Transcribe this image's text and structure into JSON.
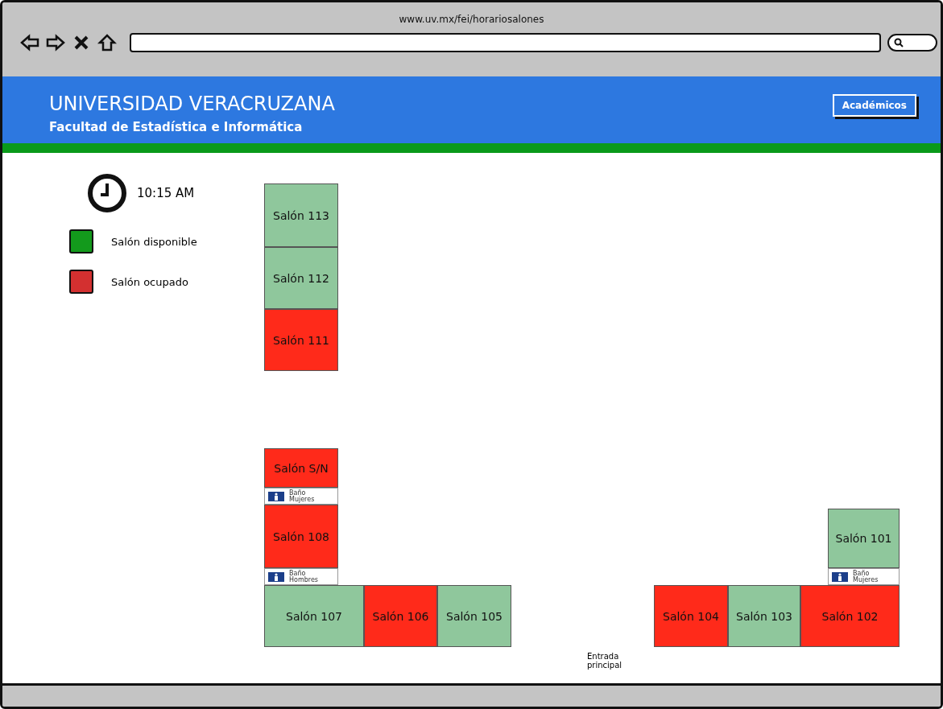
{
  "browser": {
    "url": "www.uv.mx/fei/horariosalones"
  },
  "header": {
    "title": "UNIVERSIDAD VERACRUZANA",
    "subtitle": "Facultad de Estadística e Informática",
    "button": "Académicos"
  },
  "clock": {
    "time": "10:15 AM"
  },
  "legend": [
    {
      "label": "Salón disponible",
      "color": "#139a1c"
    },
    {
      "label": "Salón ocupado",
      "color": "#d33030"
    }
  ],
  "rooms": [
    {
      "kind": "room",
      "label": "Salón 113",
      "occupied": false
    },
    {
      "kind": "room",
      "label": "Salón 112",
      "occupied": false
    },
    {
      "kind": "room",
      "label": "Salón 111",
      "occupied": true
    },
    {
      "kind": "room",
      "label": "Salón S/N",
      "occupied": true
    },
    {
      "kind": "restroom",
      "label": "Baño Mujeres"
    },
    {
      "kind": "room",
      "label": "Salón 108",
      "occupied": true
    },
    {
      "kind": "room",
      "label": "Salón 101",
      "occupied": false
    },
    {
      "kind": "restroom",
      "label": "Baño Hombres"
    },
    {
      "kind": "restroom",
      "label": "Baño Mujeres"
    },
    {
      "kind": "room",
      "label": "Salón 107",
      "occupied": false
    },
    {
      "kind": "room",
      "label": "Salón 106",
      "occupied": true
    },
    {
      "kind": "room",
      "label": "Salón 105",
      "occupied": false
    },
    {
      "kind": "room",
      "label": "Salón 104",
      "occupied": true
    },
    {
      "kind": "room",
      "label": "Salón 103",
      "occupied": false
    },
    {
      "kind": "room",
      "label": "Salón 102",
      "occupied": true
    }
  ],
  "entrance": "Entrada principal"
}
